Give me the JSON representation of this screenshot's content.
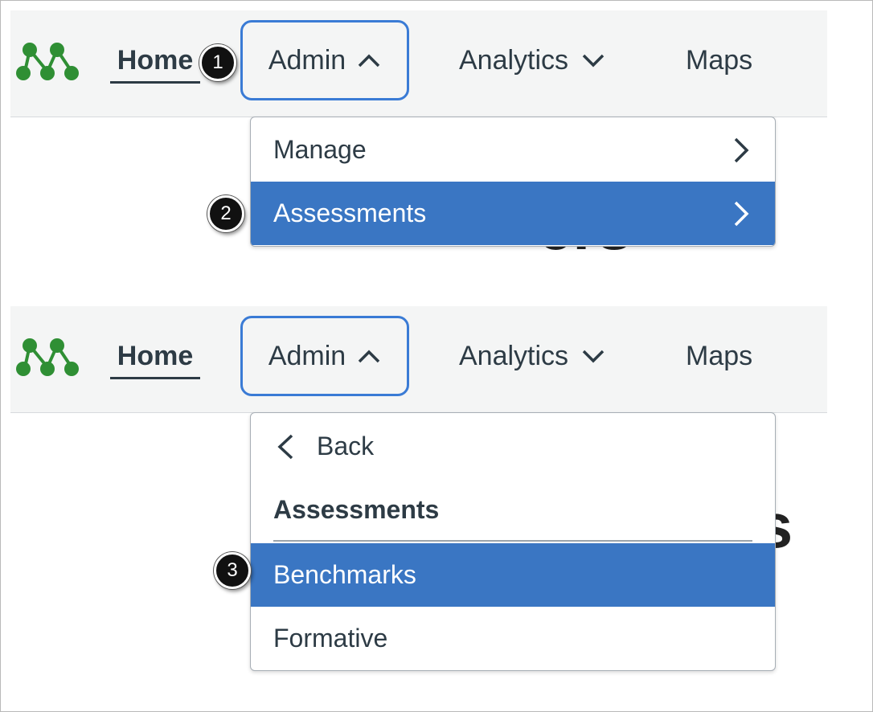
{
  "nav": {
    "home_label": "Home",
    "admin_label": "Admin",
    "analytics_label": "Analytics",
    "maps_label": "Maps",
    "logo_icon": "network-dots-icon",
    "logo_color": "#2f8f34",
    "admin_border_color": "#3a7bd5"
  },
  "menu_step1": {
    "items": [
      {
        "label": "Manage",
        "active": false
      },
      {
        "label": "Assessments",
        "active": true
      }
    ]
  },
  "menu_step2": {
    "back_label": "Back",
    "header_label": "Assessments",
    "items": [
      {
        "label": "Benchmarks",
        "active": true
      },
      {
        "label": "Formative",
        "active": false
      }
    ]
  },
  "background_text": {
    "top": "ers",
    "bottom": "ers"
  },
  "callouts": {
    "one": "1",
    "two": "2",
    "three": "3"
  },
  "colors": {
    "active_item_bg": "#3a76c3",
    "navbar_bg": "#f4f5f5",
    "text": "#2d3b45"
  }
}
